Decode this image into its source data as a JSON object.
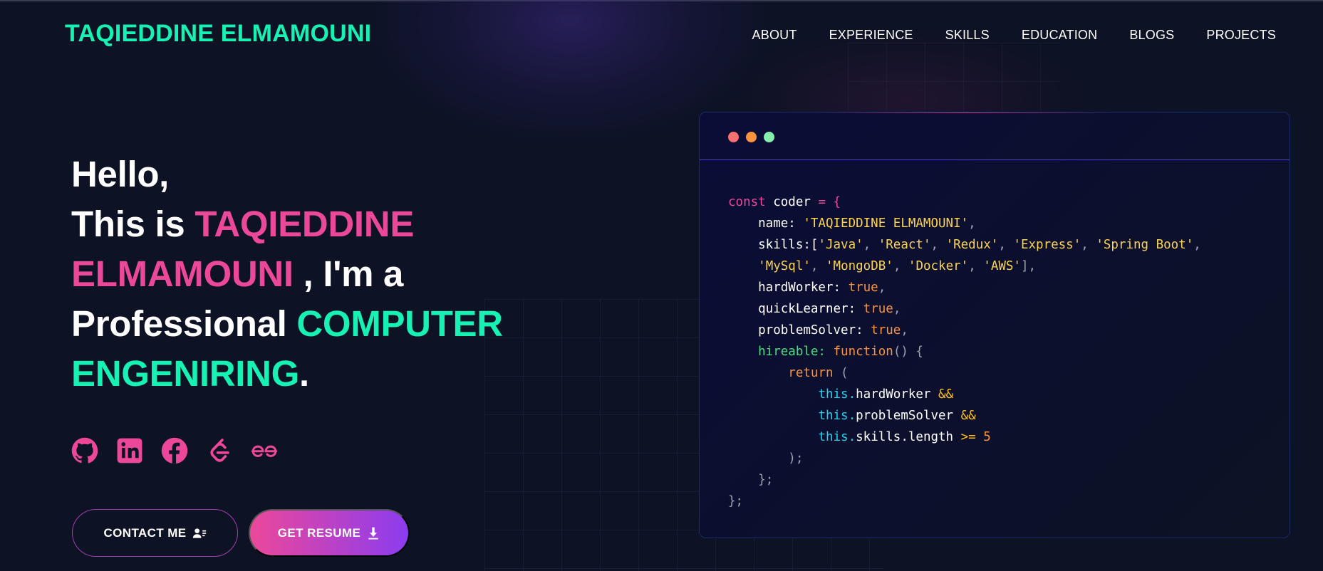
{
  "brand": "TAQIEDDINE ELMAMOUNI",
  "nav": [
    "ABOUT",
    "EXPERIENCE",
    "SKILLS",
    "EDUCATION",
    "BLOGS",
    "PROJECTS"
  ],
  "hero": {
    "hello": "Hello,",
    "this_is": "This is ",
    "name": "TAQIEDDINE ELMAMOUNI",
    "im_a": " , I'm a Professional ",
    "role": "COMPUTER ENGENIRING",
    "period": "."
  },
  "socials": [
    "github-icon",
    "linkedin-icon",
    "facebook-icon",
    "leetcode-icon",
    "geeksforgeeks-icon"
  ],
  "buttons": {
    "contact": "CONTACT ME",
    "resume": "GET RESUME"
  },
  "code": {
    "l1_const": "const",
    "l1_var": " coder ",
    "l1_eq": "= {",
    "name_key": "    name: ",
    "name_val": "'TAQIEDDINE ELMAMOUNI'",
    "skills_key": "    skills:[",
    "skills": [
      "'Java'",
      "'React'",
      "'Redux'",
      "'Express'",
      "'Spring Boot'",
      "'MySql'",
      "'MongoDB'",
      "'Docker'",
      "'AWS'"
    ],
    "hardworker_key": "    hardWorker: ",
    "quicklearner_key": "    quickLearner: ",
    "problemsolver_key": "    problemSolver: ",
    "true": "true",
    "hireable_key": "    hireable: ",
    "function_kw": "function",
    "return_kw": "return",
    "this_kw": "this.",
    "cond1": "hardWorker",
    "cond2": "problemSolver",
    "cond3": "skills.length",
    "and_op": "&&",
    "gte_op": ">=",
    "five": "5"
  },
  "colors": {
    "background": "#0d1224",
    "accent_green": "#16f2b3",
    "accent_pink": "#ec4899",
    "accent_violet": "#8b3cf0"
  }
}
